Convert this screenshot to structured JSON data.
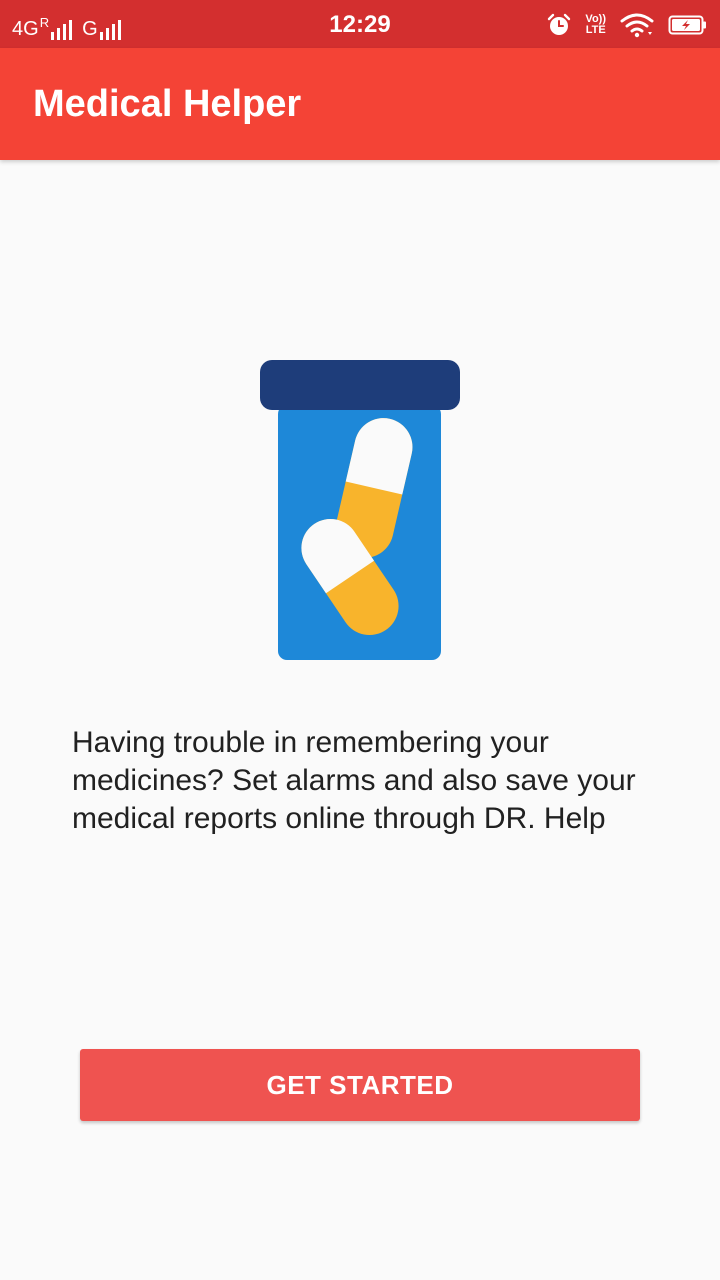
{
  "status_bar": {
    "network_label": "4G",
    "roaming_label": "R",
    "second_network_label": "G",
    "time": "12:29",
    "volte_top": "Vo))",
    "volte_bottom": "LTE",
    "icons": [
      "signal-bars-icon",
      "alarm-icon",
      "volte-icon",
      "wifi-icon",
      "battery-charging-icon"
    ]
  },
  "app_bar": {
    "title": "Medical Helper"
  },
  "main": {
    "illustration_icon": "pill-bottle-icon",
    "description": "Having trouble in remembering your medicines? Set alarms and also save your medical reports online through DR. Help",
    "button_label": "GET STARTED"
  },
  "colors": {
    "status_bar": "#d32f2f",
    "app_bar": "#f44336",
    "background": "#fafafa",
    "button": "#ef5350",
    "bottle_cap": "#1e3d7a",
    "bottle_body": "#1e88d8",
    "pill_white": "#fafafa",
    "pill_yellow": "#f8b42c"
  }
}
